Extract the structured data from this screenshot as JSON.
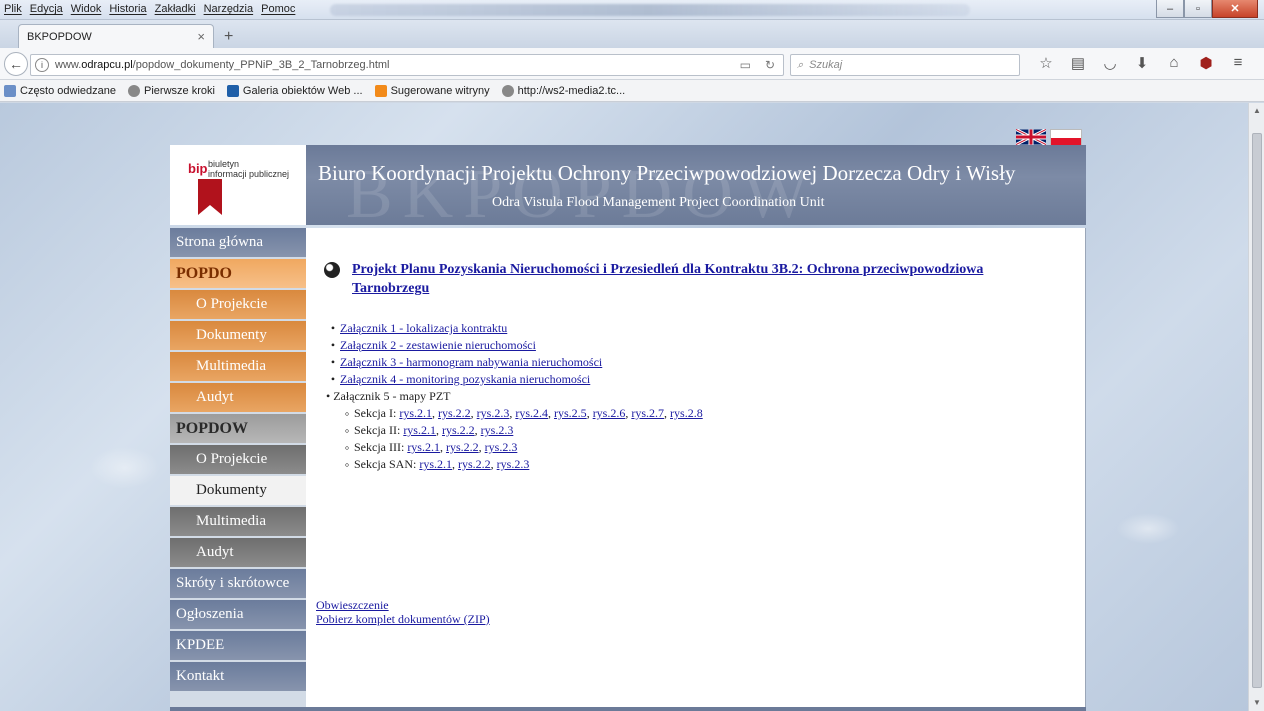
{
  "browser": {
    "menu": [
      "Plik",
      "Edycja",
      "Widok",
      "Historia",
      "Zakładki",
      "Narzędzia",
      "Pomoc"
    ],
    "tab_title": "BKPOPDOW",
    "tab_close": "×",
    "new_tab": "+",
    "url_prefix": "www.",
    "url_domain": "odrapcu.pl",
    "url_path": "/popdow_dokumenty_PPNiP_3B_2_Tarnobrzeg.html",
    "search_placeholder": "Szukaj",
    "bookmarks": [
      "Często odwiedzane",
      "Pierwsze kroki",
      "Galeria obiektów Web ...",
      "Sugerowane witryny",
      "http://ws2-media2.tc..."
    ],
    "icons": [
      "star-icon",
      "reading-list-icon",
      "pocket-icon",
      "download-icon",
      "home-icon",
      "ublock-icon",
      "menu-icon"
    ]
  },
  "header": {
    "bip_logo": "bip",
    "bip_line1": "biuletyn",
    "bip_line2": "informacji publicznej",
    "watermark": "BKPOPDOW",
    "title": "Biuro Koordynacji Projektu Ochrony Przeciwpowodziowej Dorzecza Odry i Wisły",
    "subtitle": "Odra Vistula Flood Management Project Coordination Unit"
  },
  "sidebar": {
    "home": "Strona główna",
    "popdo": "POPDO",
    "popdo_items": [
      "O Projekcie",
      "Dokumenty",
      "Multimedia",
      "Audyt"
    ],
    "popdow": "POPDOW",
    "popdow_items": [
      "O Projekcie",
      "Dokumenty",
      "Multimedia",
      "Audyt"
    ],
    "bottom_items": [
      "Skróty i skrótowce",
      "Ogłoszenia",
      "KPDEE",
      "Kontakt"
    ]
  },
  "content": {
    "title": "Projekt Planu Pozyskania Nieruchomości i Przesiedleń dla Kontraktu 3B.2: Ochrona przeciwpowodziowa Tarnobrzegu",
    "attachments": [
      "Załącznik 1 - lokalizacja kontraktu",
      "Załącznik 2 - zestawienie nieruchomości",
      "Załącznik 3 - harmonogram nabywania nieruchomości",
      "Załącznik 4 - monitoring pozyskania nieruchomości"
    ],
    "attachment5": "Załącznik 5 - mapy PZT",
    "sections": [
      {
        "label": "Sekcja I: ",
        "links": [
          "rys.2.1",
          "rys.2.2",
          "rys.2.3",
          "rys.2.4",
          "rys.2.5",
          "rys.2.6",
          "rys.2.7",
          "rys.2.8"
        ]
      },
      {
        "label": "Sekcja II: ",
        "links": [
          "rys.2.1",
          "rys.2.2",
          "rys.2.3"
        ]
      },
      {
        "label": "Sekcja III: ",
        "links": [
          "rys.2.1",
          "rys.2.2",
          "rys.2.3"
        ]
      },
      {
        "label": "Sekcja SAN: ",
        "links": [
          "rys.2.1",
          "rys.2.2",
          "rys.2.3"
        ]
      }
    ],
    "link_notice": "Obwieszczenie",
    "link_zip": "Pobierz komplet dokumentów (ZIP)"
  }
}
